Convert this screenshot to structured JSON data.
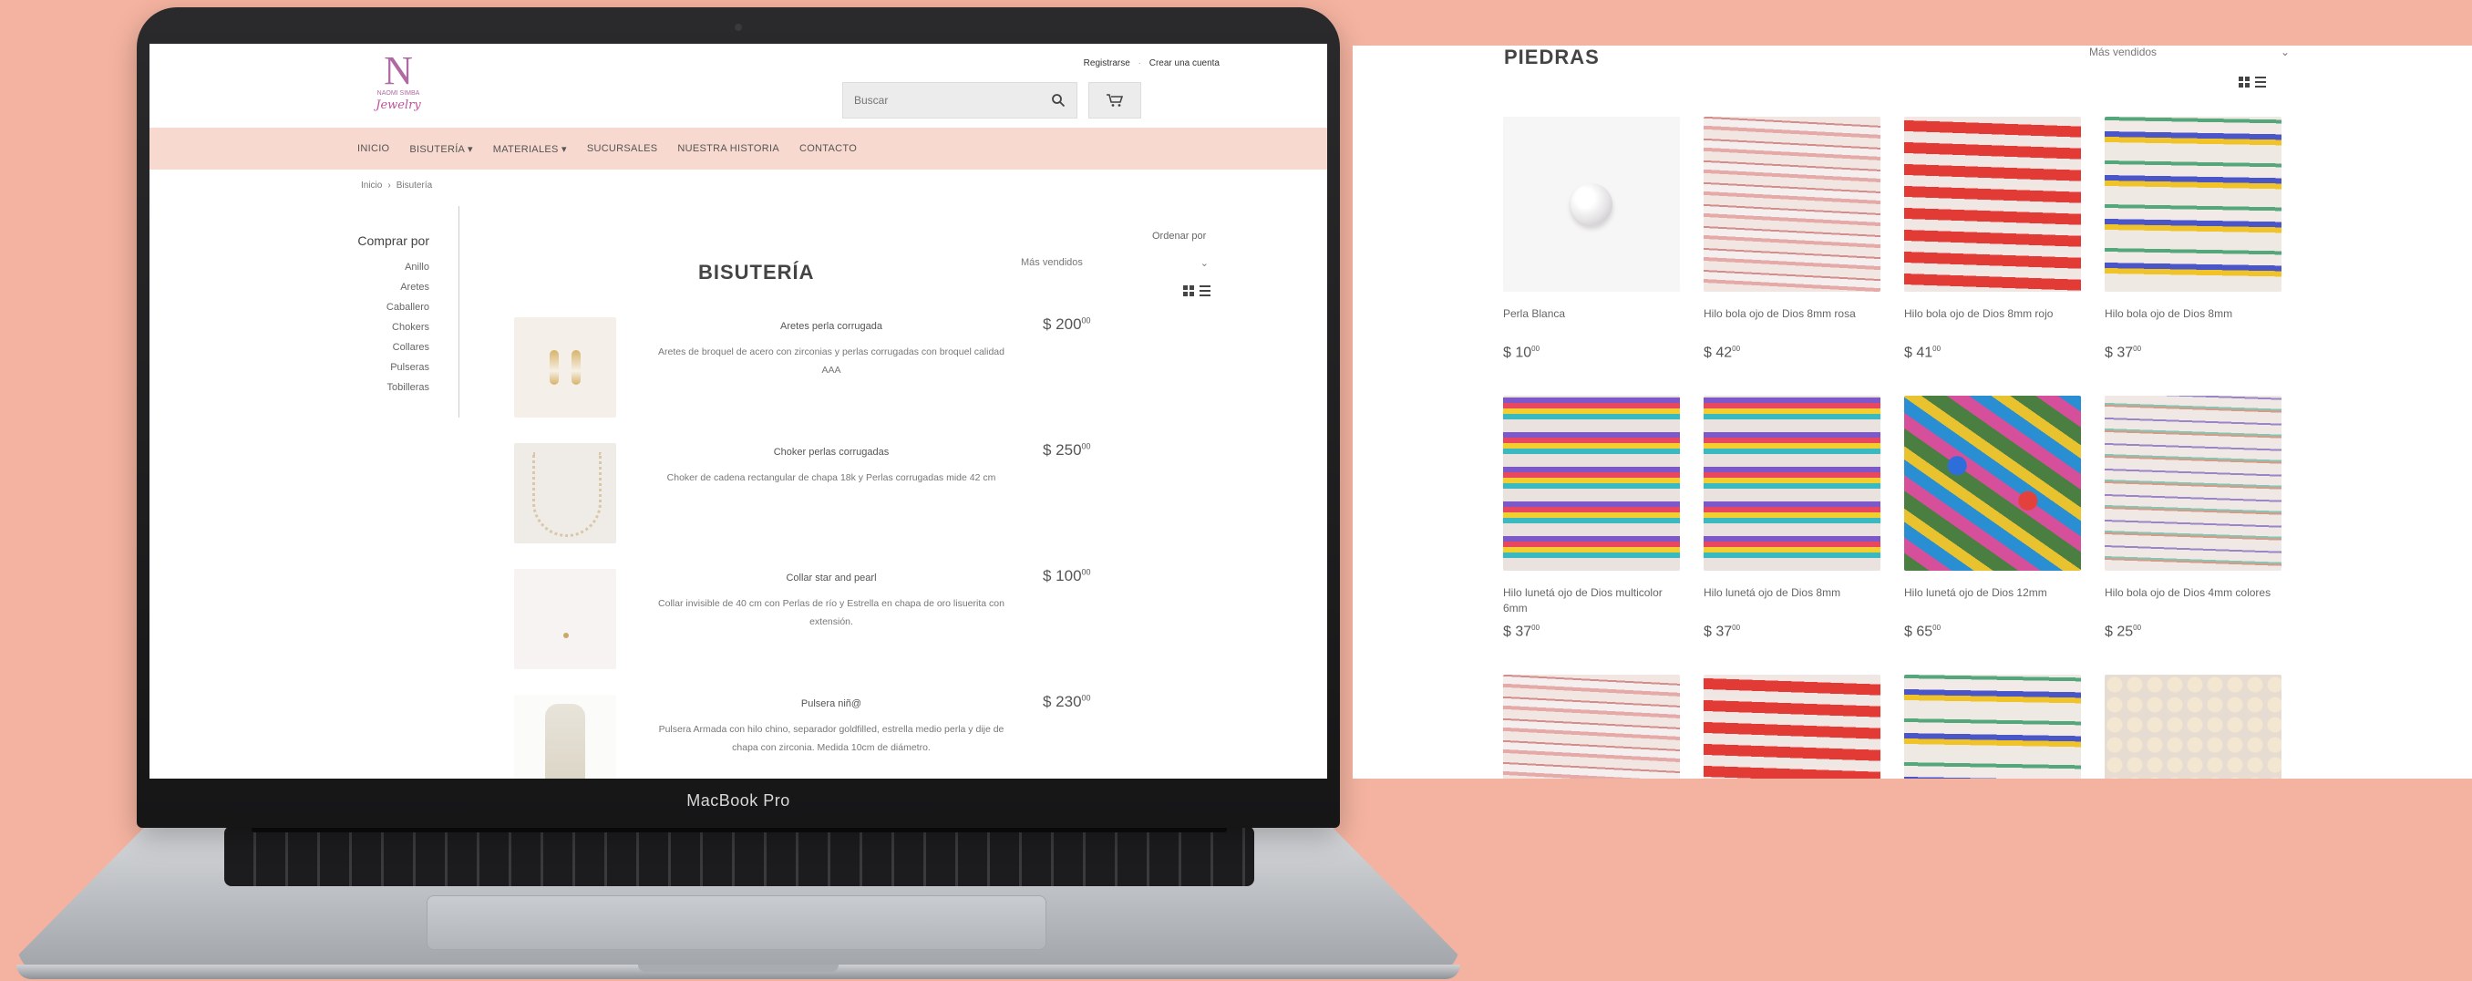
{
  "device": {
    "label": "MacBook Pro"
  },
  "site": {
    "logo": {
      "mark": "N",
      "sub": "NAOMI SIMBA",
      "script": "Jewelry"
    },
    "account": {
      "login": "Registrarse",
      "sep": "·",
      "signup": "Crear una cuenta"
    },
    "search": {
      "placeholder": "Buscar"
    },
    "nav": [
      "INICIO",
      "BISUTERÍA ▾",
      "MATERIALES ▾",
      "SUCURSALES",
      "NUESTRA HISTORIA",
      "CONTACTO"
    ],
    "breadcrumb": [
      "Inicio",
      "›",
      "Bisutería"
    ],
    "sidebar": {
      "title": "Comprar por",
      "items": [
        "Anillo",
        "Aretes",
        "Caballero",
        "Chokers",
        "Collares",
        "Pulseras",
        "Tobilleras"
      ]
    },
    "page_title": "BISUTERÍA",
    "sort": {
      "label": "Ordenar por",
      "selected": "Más vendidos",
      "arrow": "⌄"
    },
    "products": [
      {
        "name": "Aretes perla corrugada",
        "desc": "Aretes de broquel de acero con zirconias y perlas corrugadas con broquel calidad AAA",
        "price": "$ 200",
        "cents": "00"
      },
      {
        "name": "Choker perlas corrugadas",
        "desc": "Choker de cadena rectangular de chapa 18k y Perlas corrugadas mide 42 cm",
        "price": "$ 250",
        "cents": "00"
      },
      {
        "name": "Collar star and pearl",
        "desc": "Collar invisible de 40 cm con Perlas de río y Estrella en chapa de oro lisuerita con extensión.",
        "price": "$ 100",
        "cents": "00"
      },
      {
        "name": "Pulsera niñ@",
        "desc": "Pulsera Armada con hilo chino, separador goldfilled, estrella medio perla y dije de chapa con zirconia. Medida 10cm de diámetro.",
        "price": "$ 230",
        "cents": "00"
      }
    ]
  },
  "catalog": {
    "title": "PIEDRAS",
    "sort": {
      "selected": "Más vendidos",
      "arrow": "⌄"
    },
    "items": [
      {
        "name": "Perla Blanca",
        "price": "$ 10",
        "cents": "00",
        "swatch": "pearl"
      },
      {
        "name": "Hilo bola ojo de Dios 8mm rosa",
        "price": "$ 42",
        "cents": "00",
        "swatch": "pink"
      },
      {
        "name": "Hilo bola ojo de Dios 8mm rojo",
        "price": "$ 41",
        "cents": "00",
        "swatch": "red"
      },
      {
        "name": "Hilo bola ojo de Dios 8mm",
        "price": "$ 37",
        "cents": "00",
        "swatch": "multi"
      },
      {
        "name": "Hilo lunetá ojo de Dios multicolor 6mm",
        "price": "$ 37",
        "cents": "00",
        "swatch": "rain"
      },
      {
        "name": "Hilo lunetá ojo de Dios 8mm",
        "price": "$ 37",
        "cents": "00",
        "swatch": "rain"
      },
      {
        "name": "Hilo lunetá ojo de Dios 12mm",
        "price": "$ 65",
        "cents": "00",
        "swatch": "eye"
      },
      {
        "name": "Hilo bola ojo de Dios 4mm colores",
        "price": "$ 25",
        "cents": "00",
        "swatch": "fine"
      },
      {
        "name": "",
        "price": "",
        "cents": "",
        "swatch": "pink"
      },
      {
        "name": "",
        "price": "",
        "cents": "",
        "swatch": "red"
      },
      {
        "name": "",
        "price": "",
        "cents": "",
        "swatch": "multi"
      },
      {
        "name": "",
        "price": "",
        "cents": "",
        "swatch": "pearlstring"
      }
    ]
  },
  "colors": {
    "background": "#f4b3a0",
    "nav_bar": "#f7d9cf",
    "brand": "#b06aa3"
  }
}
